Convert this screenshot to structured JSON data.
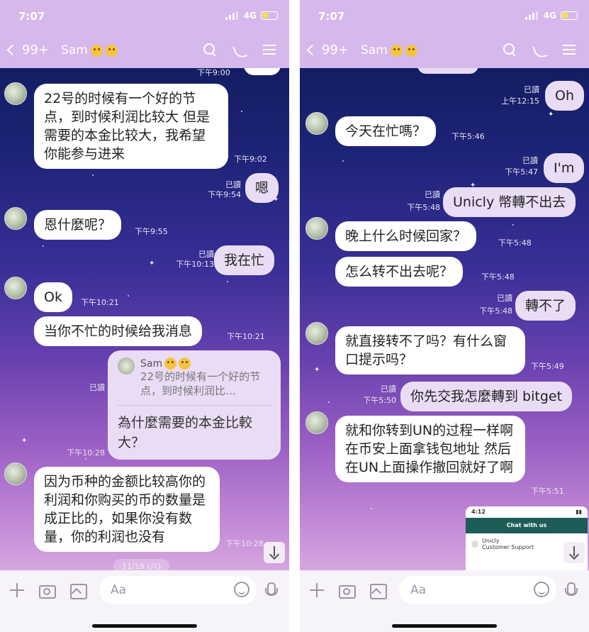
{
  "common": {
    "status_time": "7:07",
    "network": "4G",
    "back_count": "99+",
    "contact_name": "Sam",
    "input_placeholder": "Aa"
  },
  "left": {
    "top_partial_time": "下午9:00",
    "messages": [
      {
        "dir": "in",
        "text": "22号的时候有一个好的节点，到时候利润比较大 但是需要的本金比较大，我希望你能参与进来",
        "time": "下午9:02"
      },
      {
        "dir": "out",
        "text": "嗯",
        "read": "已讀",
        "time": "下午9:54"
      },
      {
        "dir": "in",
        "text": "恩什麼呢？",
        "time": "下午9:55"
      },
      {
        "dir": "out",
        "text": "我在忙",
        "read": "已讀",
        "time": "下午10:13"
      },
      {
        "dir": "in",
        "text": "Ok",
        "time": "下午10:21"
      },
      {
        "dir": "in",
        "text": "当你不忙的时候给我消息",
        "time": "下午10:21"
      },
      {
        "dir": "out",
        "text": "為什麼需要的本金比較大？",
        "read": "已讀",
        "time": "下午10:28"
      },
      {
        "dir": "in",
        "text": "因为币种的金额比较高你的利润和你购买的币的数量是成正比的，如果你没有数量，你的利润也没有",
        "time": "下午10:28"
      }
    ],
    "reply_name": "Sam",
    "reply_quote": "22号的时候有一个好的节点，到时候利润比…",
    "date_pill": "11/19 (六)"
  },
  "right": {
    "messages": [
      {
        "dir": "out",
        "text": "Oh",
        "read": "已讀",
        "time": "上午12:15"
      },
      {
        "dir": "in",
        "text": "今天在忙嗎？",
        "time": "下午5:46"
      },
      {
        "dir": "out",
        "text": "I'm",
        "read": "已讀",
        "time": "下午5:47"
      },
      {
        "dir": "out",
        "text": "Unicly 幣轉不出去",
        "read": "已讀",
        "time": "下午5:48"
      },
      {
        "dir": "in",
        "text": "晚上什么时候回家？",
        "time": "下午5:48"
      },
      {
        "dir": "in",
        "text": "怎么转不出去呢？",
        "time": "下午5:48"
      },
      {
        "dir": "out",
        "text": "轉不了",
        "read": "已讀",
        "time": "下午5:48"
      },
      {
        "dir": "in",
        "text": "就直接转不了吗？有什么窗口提示吗？",
        "time": "下午5:49"
      },
      {
        "dir": "out",
        "text": "你先交我怎麼轉到 bitget",
        "read": "已讀",
        "time": "下午5:50"
      },
      {
        "dir": "in",
        "text": "就和你转到UN的过程一样啊  在币安上面拿钱包地址  然后在UN上面操作撤回就好了啊",
        "time": "下午5:51"
      }
    ],
    "screenshot": {
      "time": "4:12",
      "header": "Chat with us",
      "contact": "Unicly",
      "subtitle": "Customer Support"
    }
  }
}
